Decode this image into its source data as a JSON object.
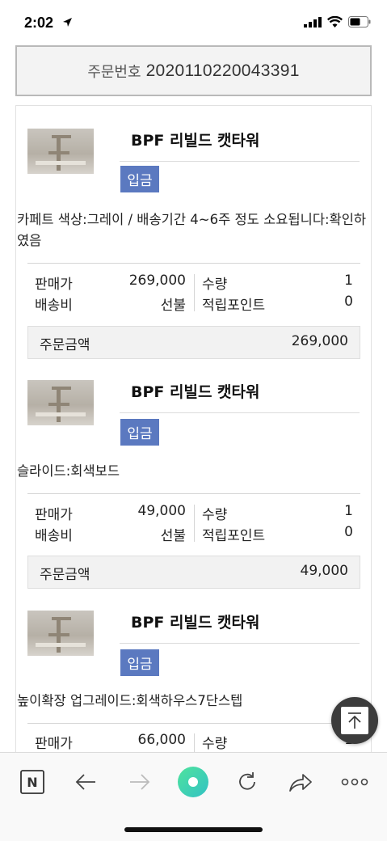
{
  "status_bar": {
    "time": "2:02"
  },
  "order": {
    "label": "주문번호",
    "number": "2020110220043391"
  },
  "items": [
    {
      "name": "BPF 리빌드 캣타워",
      "badge": "입금",
      "option": "카페트 색상:그레이 / 배송기간 4~6주 정도 소요됩니다:확인하였음",
      "price_label": "판매가",
      "price": "269,000",
      "qty_label": "수량",
      "qty": "1",
      "shipping_label": "배송비",
      "shipping": "선불",
      "points_label": "적립포인트",
      "points": "0",
      "total_label": "주문금액",
      "total": "269,000"
    },
    {
      "name": "BPF 리빌드 캣타워",
      "badge": "입금",
      "option": "슬라이드:회색보드",
      "price_label": "판매가",
      "price": "49,000",
      "qty_label": "수량",
      "qty": "1",
      "shipping_label": "배송비",
      "shipping": "선불",
      "points_label": "적립포인트",
      "points": "0",
      "total_label": "주문금액",
      "total": "49,000"
    },
    {
      "name": "BPF 리빌드 캣타워",
      "badge": "입금",
      "option": "높이확장 업그레이드:회색하우스7단스텝",
      "price_label": "판매가",
      "price": "66,000",
      "qty_label": "수량",
      "qty": "1"
    }
  ],
  "toolbar": {
    "icons": [
      "naver-n-icon",
      "back-arrow-icon",
      "forward-arrow-icon",
      "green-home-icon",
      "refresh-icon",
      "share-icon",
      "more-icon"
    ]
  },
  "colors": {
    "badge": "#5b79c0",
    "green_button": "#47d8a8"
  }
}
